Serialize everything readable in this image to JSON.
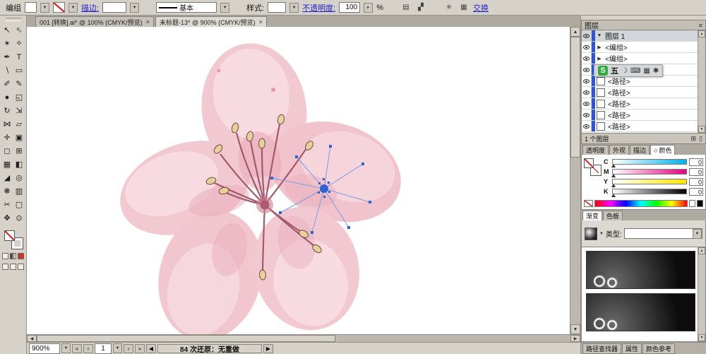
{
  "ui": {
    "dd": "▼",
    "spin": "▸",
    "up": "▲",
    "down": "▼",
    "left": "◀",
    "right": "▶",
    "menu": "≡"
  },
  "control_bar": {
    "mode": "编组",
    "stroke_link": "描边:",
    "brush_name": "基本",
    "style_label": "样式:",
    "opacity_link": "不透明度:",
    "opacity_value": "100",
    "percent": "%",
    "swap_link": "交换",
    "icons": {
      "graph1": "▤",
      "graph2": "▞",
      "gear": "✳",
      "grid": "▦"
    }
  },
  "doc_tabs": {
    "close_glyph": "×",
    "tabs": [
      {
        "title": "001 [转换].ai* @ 100% (CMYK/预览)"
      },
      {
        "title": "未标题-13* @ 900% (CMYK/预览)"
      }
    ]
  },
  "toolbox": {
    "tools": [
      {
        "name": "selection",
        "glyph": "↖"
      },
      {
        "name": "direct-selection",
        "glyph": "⇖"
      },
      {
        "name": "magic-wand",
        "glyph": "✶"
      },
      {
        "name": "lasso",
        "glyph": "⟡"
      },
      {
        "name": "pen",
        "glyph": "✒"
      },
      {
        "name": "type",
        "glyph": "T"
      },
      {
        "name": "line",
        "glyph": "∖"
      },
      {
        "name": "rectangle",
        "glyph": "▭"
      },
      {
        "name": "paintbrush",
        "glyph": "✐"
      },
      {
        "name": "pencil",
        "glyph": "✎"
      },
      {
        "name": "blob-brush",
        "glyph": "●"
      },
      {
        "name": "eraser",
        "glyph": "◱"
      },
      {
        "name": "rotate",
        "glyph": "↻"
      },
      {
        "name": "scale",
        "glyph": "⇲"
      },
      {
        "name": "width",
        "glyph": "⋈"
      },
      {
        "name": "free-transform",
        "glyph": "▱"
      },
      {
        "name": "shape-builder",
        "glyph": "✛"
      },
      {
        "name": "live-paint-bucket",
        "glyph": "▣"
      },
      {
        "name": "live-paint-selection",
        "glyph": "◻"
      },
      {
        "name": "perspective-grid",
        "glyph": "⊞"
      },
      {
        "name": "mesh",
        "glyph": "▦"
      },
      {
        "name": "gradient",
        "glyph": "◧"
      },
      {
        "name": "eyedropper",
        "glyph": "◢"
      },
      {
        "name": "blend",
        "glyph": "◎"
      },
      {
        "name": "symbol-sprayer",
        "glyph": "❋"
      },
      {
        "name": "graph",
        "glyph": "▥"
      },
      {
        "name": "scissors",
        "glyph": "✂"
      },
      {
        "name": "artboard",
        "glyph": "▢"
      },
      {
        "name": "hand",
        "glyph": "✥"
      },
      {
        "name": "zoom",
        "glyph": "⊙"
      }
    ]
  },
  "layers_panel": {
    "title": "图层",
    "rows": [
      {
        "expander": "▼",
        "label": "图层 1",
        "target": "○"
      },
      {
        "expander": "▶",
        "label": "<编组>",
        "target": "○"
      },
      {
        "expander": "▶",
        "label": "<编组>",
        "target": "○"
      },
      {
        "label": "<路径>",
        "target": "◎"
      },
      {
        "label": "<路径>",
        "target": "○"
      },
      {
        "label": "<路径>",
        "target": "○"
      },
      {
        "label": "<路径>",
        "target": "○"
      },
      {
        "label": "<路径>",
        "target": "○"
      },
      {
        "label": "<路径>",
        "target": "○"
      }
    ],
    "footer": "1 个图层",
    "footer_icons": {
      "new_sublayer": "⊞",
      "trash": "▯"
    }
  },
  "ime_bar": {
    "badge": "S",
    "mode": "五",
    "icon1": "☽",
    "icon2": "⌨",
    "icon3": "▦",
    "icon4": "✱"
  },
  "panel_tabs": {
    "group1": [
      "透明度",
      "外观",
      "描边"
    ],
    "color_tab_icon": "◇",
    "color_tab": "颜色",
    "group2": [
      "渐变",
      "色板"
    ],
    "group3": [
      "路径查找器",
      "属性",
      "颜色参考"
    ]
  },
  "color_panel": {
    "sliders": [
      {
        "ch": "C",
        "value": "0"
      },
      {
        "ch": "M",
        "value": "0"
      },
      {
        "ch": "Y",
        "value": "0"
      },
      {
        "ch": "K",
        "value": "0"
      }
    ]
  },
  "gradient_panel": {
    "type_label": "类型:"
  },
  "status_bar": {
    "zoom": "900%",
    "page": "1",
    "message": "84 次还原：无重做",
    "nav": {
      "first": "«",
      "prev": "‹",
      "next": "›",
      "last": "»"
    }
  },
  "palette": {
    "petal": "#f3c9d1",
    "petal_light": "#f8dbe1",
    "petal_dark": "#e9adbc",
    "stamen": "#a2596c",
    "anther": "#e8d09e",
    "selection_blue": "#2f63d0"
  }
}
